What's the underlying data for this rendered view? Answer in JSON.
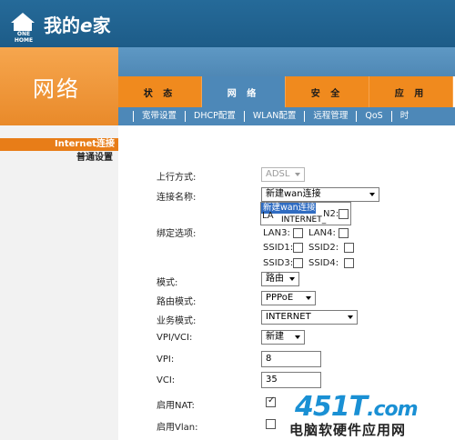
{
  "brand": {
    "logo_caption": "ONE HOME",
    "name_pre": "我的",
    "name_e": "e",
    "name_post": "家"
  },
  "section_title": "网络",
  "tabs": [
    {
      "label": "状 态"
    },
    {
      "label": "网 络"
    },
    {
      "label": "安 全"
    },
    {
      "label": "应 用"
    }
  ],
  "subnav": [
    "宽带设置",
    "DHCP配置",
    "WLAN配置",
    "远程管理",
    "QoS",
    "时"
  ],
  "leftnav": {
    "active": "Internet连接",
    "item": "普通设置"
  },
  "form": {
    "uplink_label": "上行方式:",
    "uplink_value": "ADSL",
    "conn_name_label": "连接名称:",
    "conn_name_value": "新建wan连接",
    "dropdown_options": [
      "新建wan连接",
      "INTERNET_"
    ],
    "bind_label": "绑定选项:",
    "lan_partial": "LA",
    "lan2_partial": "N2:",
    "lan3": "LAN3:",
    "lan4": "LAN4:",
    "ssid1": "SSID1:",
    "ssid2": "SSID2:",
    "ssid3": "SSID3:",
    "ssid4": "SSID4:",
    "mode_label": "模式:",
    "mode_value": "路由",
    "route_mode_label": "路由模式:",
    "route_mode_value": "PPPoE",
    "service_label": "业务模式:",
    "service_value": "INTERNET",
    "vpivci_label": "VPI/VCI:",
    "vpivci_value": "新建",
    "vpi_label": "VPI:",
    "vpi_value": "8",
    "vci_label": "VCI:",
    "vci_value": "35",
    "nat_label": "启用NAT:",
    "nat_checked": true,
    "vlan_label": "启用Vlan:",
    "vlan_checked": false
  },
  "watermark": {
    "big": "451T",
    "domain": ".com",
    "small": "电脑软硬件应用网"
  }
}
